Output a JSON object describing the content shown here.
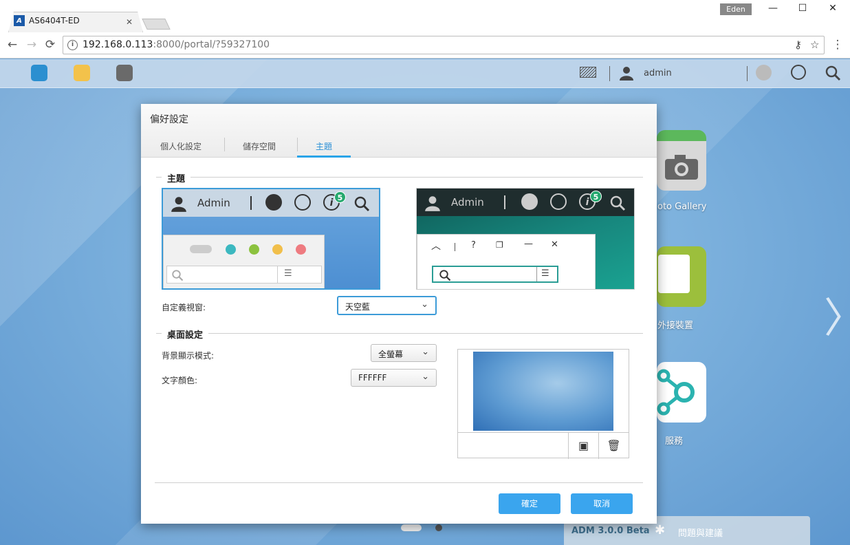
{
  "browser": {
    "tab_title": "AS6404T-ED",
    "tab_close": "✕",
    "profile_name": "Eden",
    "url_host": "192.168.0.113",
    "url_rest": ":8000/portal/?59327100",
    "back": "←",
    "forward": "→",
    "reload": "⟳",
    "info": "i",
    "minimize": "—",
    "maximize": "☐",
    "close": "✕",
    "star": "☆",
    "menu": "⋮",
    "key": "⚷"
  },
  "taskbar": {
    "user": "admin"
  },
  "desktop": {
    "apps": [
      {
        "label": "oto Gallery"
      },
      {
        "label": "外接裝置"
      },
      {
        "label": "服務"
      }
    ],
    "beta_label": "ADM 3.0.0 Beta",
    "feedback_label": "問題與建議"
  },
  "dialog": {
    "title": "偏好設定",
    "tabs": [
      {
        "label": "個人化設定"
      },
      {
        "label": "儲存空間"
      },
      {
        "label": "主題"
      }
    ],
    "theme_section": {
      "title": "主題",
      "preview_light": {
        "user": "Admin",
        "badge": "5"
      },
      "preview_dark": {
        "user": "Admin",
        "badge": "5"
      },
      "custom_window_label": "自定義視窗:",
      "custom_window_value": "天空藍"
    },
    "desktop_section": {
      "title": "桌面設定",
      "bg_mode_label": "背景顯示模式:",
      "bg_mode_value": "全螢幕",
      "text_color_label": "文字顏色:",
      "text_color_value": "FFFFFF"
    },
    "ok_label": "確定",
    "cancel_label": "取消"
  },
  "colors": {
    "accent": "#3aa5ee",
    "tab_active": "#2a8fd6",
    "badge_green": "#26a96f"
  }
}
